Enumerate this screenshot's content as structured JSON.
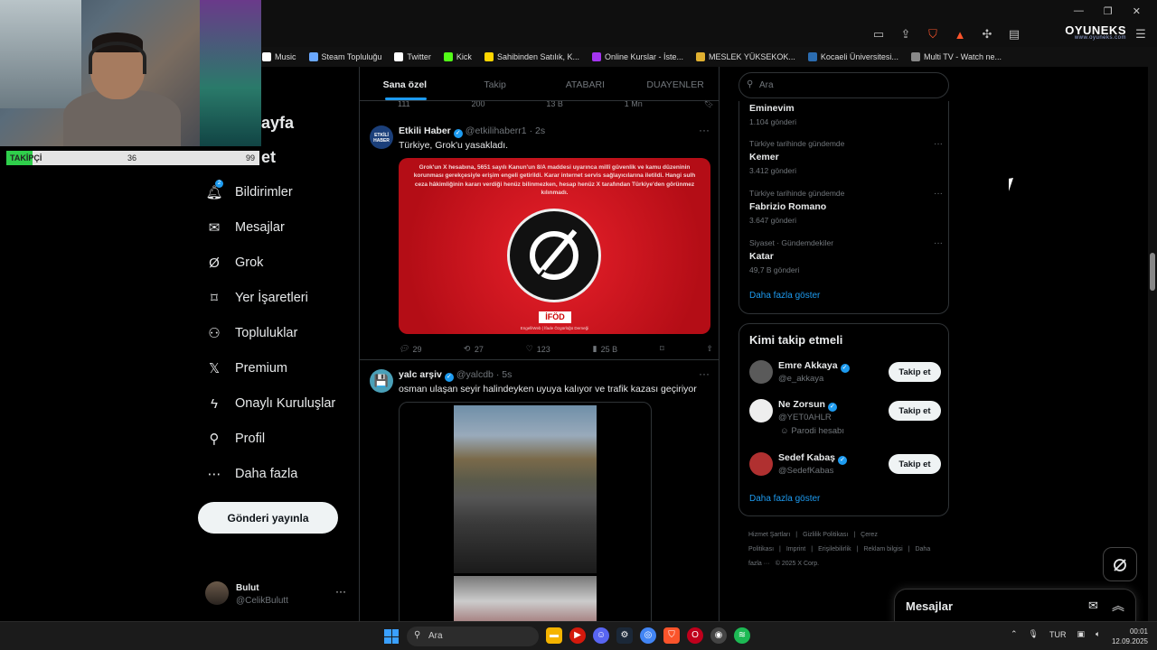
{
  "browser": {
    "window_controls": [
      "—",
      "❐",
      "✕"
    ],
    "logo_text": "OYUNEKS",
    "logo_sub": "www.oyuneks.com",
    "bookmarks": [
      {
        "label": "Music",
        "color": "#ffffff"
      },
      {
        "label": "Steam Topluluğu",
        "color": "#6aa8ff"
      },
      {
        "label": "Twitter",
        "color": "#ffffff"
      },
      {
        "label": "Kick",
        "color": "#53fc18"
      },
      {
        "label": "Sahibinden Satılık, K...",
        "color": "#ffd600"
      },
      {
        "label": "Online Kurslar - İste...",
        "color": "#a435f0"
      },
      {
        "label": "MESLEK YÜKSEKOK...",
        "color": "#e0b030"
      },
      {
        "label": "Kocaeli Üniversitesi...",
        "color": "#2b6cb0"
      },
      {
        "label": "Multi TV - Watch ne...",
        "color": "#888888"
      }
    ]
  },
  "stream_overlay": {
    "follower_label": "TAKİPÇİ",
    "follower_current": "36",
    "follower_goal": "99",
    "follower_fraction": 0.36
  },
  "nav": {
    "partial_home": "ayfa",
    "partial_explore": "et",
    "notification_badge": "2",
    "items": [
      {
        "label": "Bildirimler",
        "icon": "bell-icon"
      },
      {
        "label": "Mesajlar",
        "icon": "mail-icon"
      },
      {
        "label": "Grok",
        "icon": "grok-icon"
      },
      {
        "label": "Yer İşaretleri",
        "icon": "bookmark-icon"
      },
      {
        "label": "Topluluklar",
        "icon": "people-icon"
      },
      {
        "label": "Premium",
        "icon": "x-logo-icon"
      },
      {
        "label": "Onaylı Kuruluşlar",
        "icon": "lightning-icon"
      },
      {
        "label": "Profil",
        "icon": "person-icon"
      },
      {
        "label": "Daha fazla",
        "icon": "more-circle-icon"
      }
    ],
    "post_button": "Gönderi yayınla",
    "account": {
      "name": "Bulut",
      "handle": "@CelikBulutt",
      "more": "···"
    }
  },
  "timeline": {
    "tabs": [
      "Sana özel",
      "Takip",
      "ATABARI",
      "DUAYENLER"
    ],
    "prev_actions": {
      "replies": "111",
      "reposts": "200",
      "likes": "13 B",
      "views": "1 Mn"
    },
    "tweets": [
      {
        "avatar_text": "ETKİLİ HABER",
        "name": "Etkili Haber",
        "handle": "@etkilihaberr1",
        "time": "· 2s",
        "text": "Türkiye, Grok'u yasakladı.",
        "media_note": "Grok'un X hesabına, 5651 sayılı Kanun'un 8/A maddesi uyarınca millî güvenlik ve kamu düzeninin korunması gerekçesiyle erişim engeli getirildi. Karar internet servis sağlayıcılarına iletildi. Hangi sulh ceza hâkimliğinin kararı verdiği henüz bilinmezken, hesap henüz X tarafından Türkiye'den görünmez kılınmadı.",
        "media_logo": "İFÖD",
        "media_footer": "EngelliWeb | İfade Özgürlüğü Derneği",
        "replies": "29",
        "reposts": "27",
        "likes": "123",
        "views": "25 B"
      },
      {
        "avatar_text": "💾",
        "name": "yalc arşiv",
        "handle": "@yalcdb",
        "time": "· 5s",
        "text": "osman ulaşan seyir halindeyken uyuya kalıyor ve trafik kazası geçiriyor"
      }
    ]
  },
  "sidebar": {
    "search_placeholder": "Ara",
    "trends": [
      {
        "category": "",
        "name": "Eminevim",
        "count": "1.104 gönderi"
      },
      {
        "category": "Türkiye tarihinde gündemde",
        "name": "Kemer",
        "count": "3.412 gönderi"
      },
      {
        "category": "Türkiye tarihinde gündemde",
        "name": "Fabrizio Romano",
        "count": "3.647 gönderi"
      },
      {
        "category": "Siyaset · Gündemdekiler",
        "name": "Katar",
        "count": "49,7 B gönderi"
      }
    ],
    "trends_more": "Daha fazla göster",
    "who_to_follow_title": "Kimi takip etmeli",
    "users": [
      {
        "name": "Emre Akkaya",
        "handle": "@e_akkaya",
        "badge": "",
        "button": "Takip et",
        "avatar_color": "#5a5a5a"
      },
      {
        "name": "Ne Zorsun",
        "handle": "@YET0AHLR",
        "badge": "Parodi hesabı",
        "button": "Takip et",
        "avatar_color": "#eeeeee"
      },
      {
        "name": "Sedef Kabaş",
        "handle": "@SedefKabas",
        "badge": "",
        "button": "Takip et",
        "avatar_color": "#b03030"
      }
    ],
    "users_more": "Daha fazla göster",
    "footer_links": [
      "Hizmet Şartları",
      "|",
      "Gizlilik Politikası",
      "|",
      "Çerez Politikası",
      "|",
      "Imprint",
      "|",
      "Erişilebilirlik",
      "|",
      "Reklam bilgisi",
      "|",
      "Daha fazla ···",
      "© 2025 X Corp."
    ]
  },
  "drawer": {
    "title": "Mesajlar"
  },
  "taskbar": {
    "search_placeholder": "Ara",
    "language": "TUR",
    "time": "00:01",
    "date": "12.09.2025"
  },
  "colors": {
    "accent": "#1d9bf0",
    "follower_bar": "#2fcf4b",
    "media_red": "#e8202a"
  }
}
